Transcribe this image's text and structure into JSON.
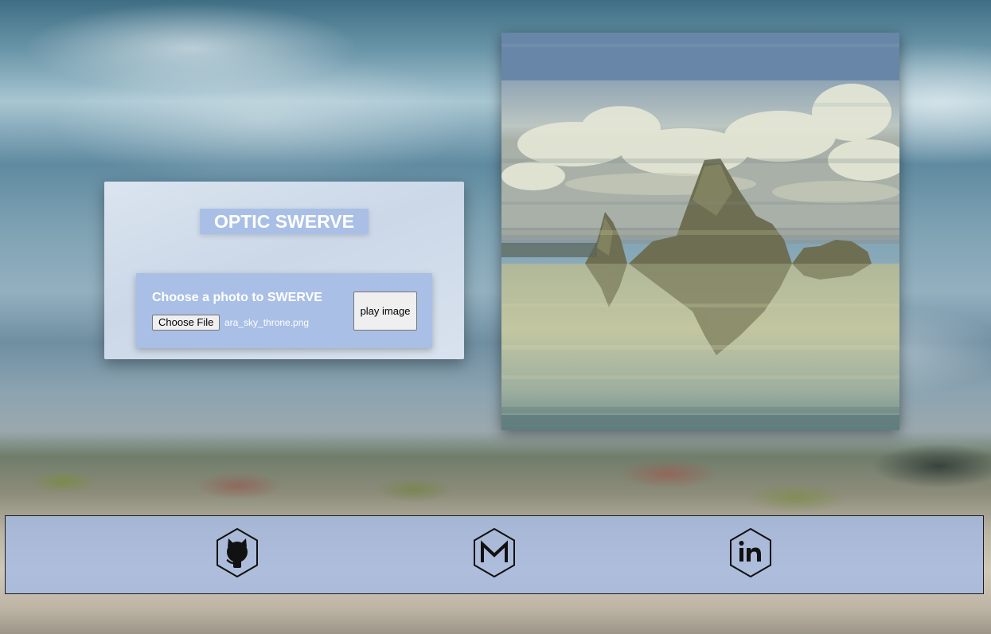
{
  "app": {
    "title": "OPTIC SWERVE"
  },
  "uploader": {
    "prompt": "Choose a photo to SWERVE",
    "choose_file_label": "Choose File",
    "selected_file": "ara_sky_throne.png",
    "play_label": "play image"
  },
  "preview": {
    "subject": "swerved lake image with rock formation and clouds"
  },
  "footer": {
    "links": [
      {
        "icon": "github-icon"
      },
      {
        "icon": "gmail-icon"
      },
      {
        "icon": "linkedin-icon"
      }
    ]
  },
  "colors": {
    "accent": "#a9bfe6",
    "card_bg": "#d3dded",
    "title_text": "#ffffff"
  }
}
